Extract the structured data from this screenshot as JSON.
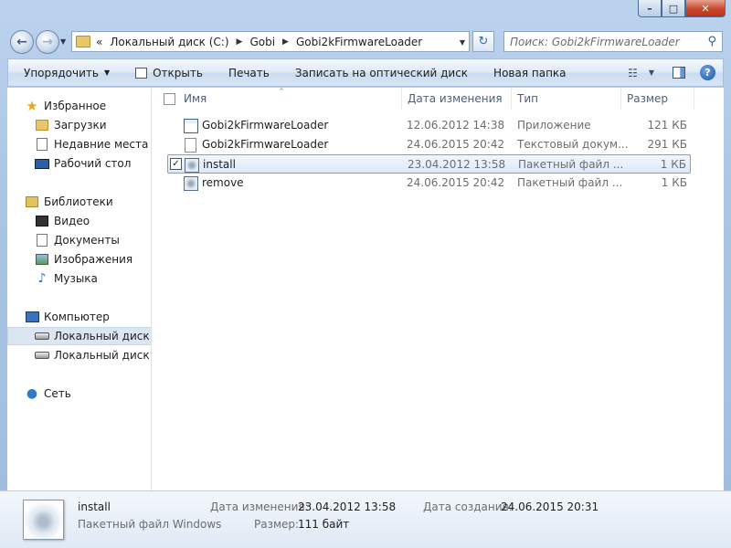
{
  "window": {
    "controls": {
      "minimize": "–",
      "maximize": "□",
      "close": "✕"
    }
  },
  "nav": {
    "back_glyph": "←",
    "forward_glyph": "→",
    "history_glyph": "▼"
  },
  "address": {
    "prefix": "«",
    "crumbs": [
      "Локальный диск (C:)",
      "Gobi",
      "Gobi2kFirmwareLoader"
    ],
    "separator": "▶",
    "dropdown": "▼",
    "refresh_glyph": "↻"
  },
  "search": {
    "placeholder": "Поиск: Gobi2kFirmwareLoader",
    "icon": "magnifier-icon"
  },
  "toolbar": {
    "organize": "Упорядочить",
    "open": "Открыть",
    "print": "Печать",
    "burn": "Записать на оптический диск",
    "new_folder": "Новая папка",
    "dropdown_glyph": "▼",
    "help_glyph": "?"
  },
  "sidebar": {
    "favorites": {
      "label": "Избранное",
      "items": [
        "Загрузки",
        "Недавние места",
        "Рабочий стол"
      ]
    },
    "libraries": {
      "label": "Библиотеки",
      "items": [
        "Видео",
        "Документы",
        "Изображения",
        "Музыка"
      ]
    },
    "computer": {
      "label": "Компьютер",
      "items": [
        "Локальный диск (C",
        "Локальный диск (E:"
      ]
    },
    "network": {
      "label": "Сеть"
    }
  },
  "columns": {
    "name": "Имя",
    "date": "Дата изменения",
    "type": "Тип",
    "size": "Размер",
    "sort_glyph": "^"
  },
  "files": [
    {
      "name": "Gobi2kFirmwareLoader",
      "date": "12.06.2012 14:38",
      "type": "Приложение",
      "size": "121 КБ",
      "icon": "app-icon"
    },
    {
      "name": "Gobi2kFirmwareLoader",
      "date": "24.06.2015 20:42",
      "type": "Текстовый докум...",
      "size": "291 КБ",
      "icon": "text-file-icon"
    },
    {
      "name": "install",
      "date": "23.04.2012 13:58",
      "type": "Пакетный файл ...",
      "size": "1 КБ",
      "icon": "batch-file-icon",
      "selected": true,
      "check": "✓"
    },
    {
      "name": "remove",
      "date": "24.06.2015 20:42",
      "type": "Пакетный файл ...",
      "size": "1 КБ",
      "icon": "batch-file-icon"
    }
  ],
  "details": {
    "name": "install",
    "type": "Пакетный файл Windows",
    "modified_label": "Дата изменения:",
    "modified_value": "23.04.2012 13:58",
    "size_label": "Размер:",
    "size_value": "111 байт",
    "created_label": "Дата создания:",
    "created_value": "24.06.2015 20:31"
  }
}
